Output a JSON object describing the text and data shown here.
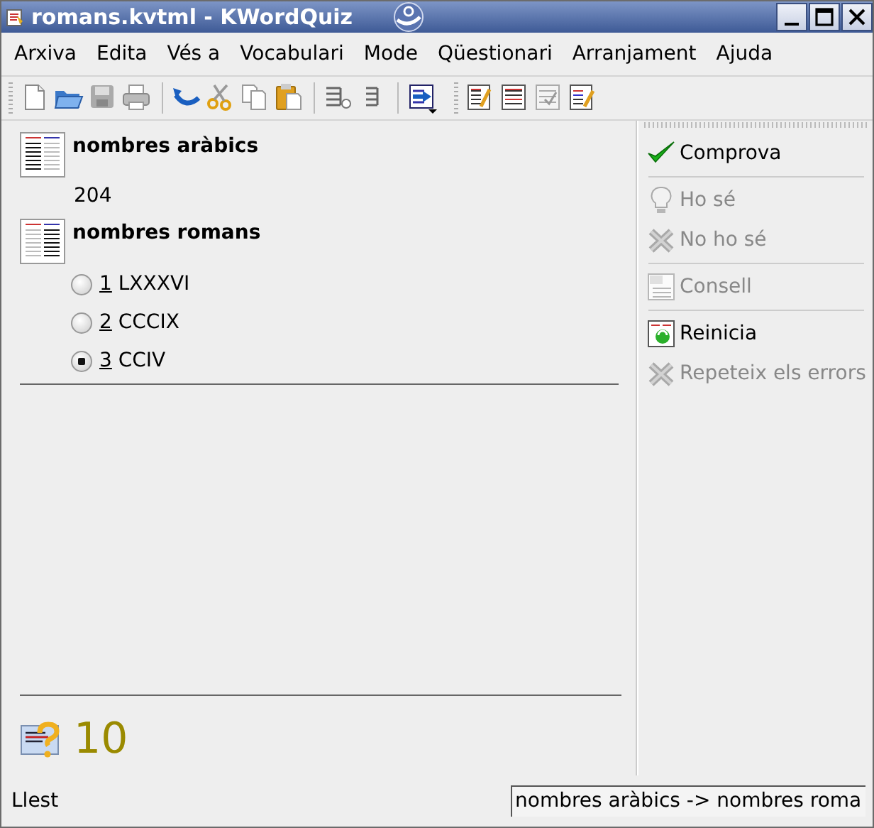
{
  "window": {
    "title": "romans.kvtml - KWordQuiz"
  },
  "menu": [
    {
      "label": "Arxiva"
    },
    {
      "label": "Edita"
    },
    {
      "label": "Vés a"
    },
    {
      "label": "Vocabulari"
    },
    {
      "label": "Mode"
    },
    {
      "label": "Qüestionari"
    },
    {
      "label": "Arranjament"
    },
    {
      "label": "Ajuda"
    }
  ],
  "question": {
    "heading": "nombres aràbics",
    "text": "204"
  },
  "answer": {
    "heading": "nombres romans",
    "options": [
      {
        "number": "1",
        "label": "LXXXVI",
        "selected": false
      },
      {
        "number": "2",
        "label": "CCCIX",
        "selected": false
      },
      {
        "number": "3",
        "label": "CCIV",
        "selected": true
      }
    ]
  },
  "score": {
    "value": "10"
  },
  "actions": [
    {
      "items": [
        {
          "label": "Comprova",
          "kind": "check",
          "disabled": false
        }
      ]
    },
    {
      "items": [
        {
          "label": "Ho sé",
          "kind": "bulb",
          "disabled": true
        },
        {
          "label": "No ho sé",
          "kind": "cross",
          "disabled": true
        }
      ]
    },
    {
      "items": [
        {
          "label": "Consell",
          "kind": "hint",
          "disabled": true
        }
      ]
    },
    {
      "items": [
        {
          "label": "Reinicia",
          "kind": "restart",
          "disabled": false
        },
        {
          "label": "Repeteix els errors",
          "kind": "cross",
          "disabled": true
        }
      ]
    }
  ],
  "status_bar": {
    "message": "Llest",
    "mode": "nombres aràbics -> nombres roma"
  }
}
